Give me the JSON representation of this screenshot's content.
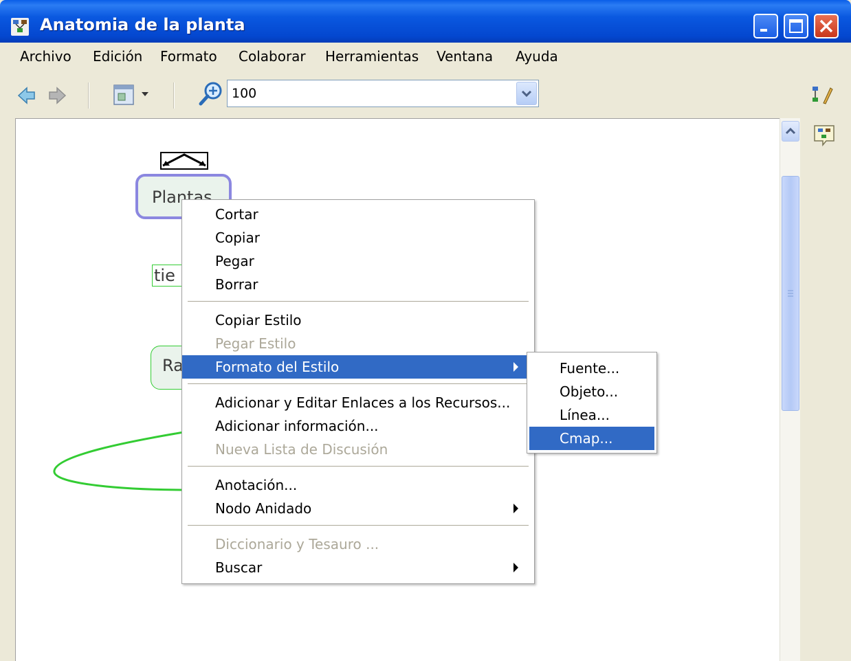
{
  "window": {
    "title": "Anatomia de la planta"
  },
  "menubar": {
    "items": [
      "Archivo",
      "Edición",
      "Formato",
      "Colaborar",
      "Herramientas",
      "Ventana",
      "Ayuda"
    ]
  },
  "toolbar": {
    "zoom_value": "100"
  },
  "canvas": {
    "concepts": {
      "plantas": "Plantas",
      "tiene_fragment": "tie",
      "raiz_fragment": "Ra"
    }
  },
  "context_menu": {
    "items": [
      "Cortar",
      "Copiar",
      "Pegar",
      "Borrar",
      "Copiar Estilo",
      "Pegar Estilo",
      "Formato del Estilo",
      "Adicionar y Editar Enlaces a los Recursos...",
      "Adicionar información...",
      "Nueva Lista de Discusión",
      "Anotación...",
      "Nodo Anidado",
      "Diccionario y Tesauro ...",
      "Buscar"
    ],
    "selected": "Formato del Estilo"
  },
  "submenu": {
    "items": [
      "Fuente...",
      "Objeto...",
      "Línea...",
      "Cmap..."
    ],
    "selected": "Cmap..."
  },
  "colors": {
    "selection": "#316ac5",
    "title_bar": "#0a58e0",
    "concept_link": "#33cc33",
    "concept_selected_border": "#8b87e0"
  }
}
